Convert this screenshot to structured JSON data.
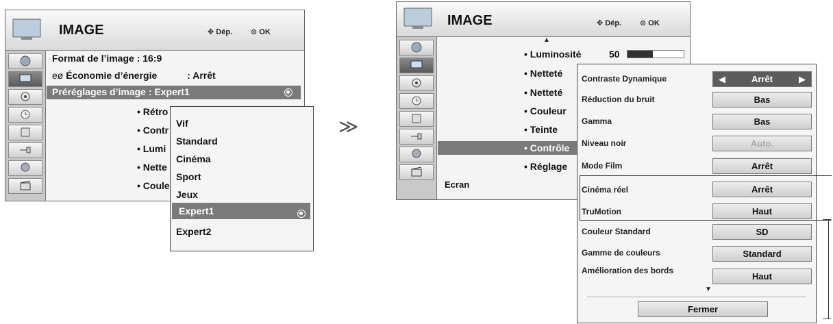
{
  "left": {
    "title": "IMAGE",
    "nav_hint": "Dép.",
    "ok_hint": "OK",
    "rows": {
      "format": "Format de l’image   : 16:9",
      "eco_label": "Économie d’énergie",
      "eco_value": ": Arrêt",
      "preset": "Préréglages d’image  :  Expert1"
    },
    "sub_items": [
      "• Rétro",
      "• Contr",
      "• Lumi",
      "• Nette",
      "• Coule"
    ],
    "dropdown": [
      "Vif",
      "Standard",
      "Cinéma",
      "Sport",
      "Jeux",
      "Expert1",
      "Expert2"
    ],
    "dropdown_selected": "Expert1"
  },
  "arrow": "≫",
  "right": {
    "title": "IMAGE",
    "nav_hint": "Dép.",
    "ok_hint": "OK",
    "list": [
      "• Luminosité",
      "• Netteté",
      "• Netteté",
      "• Couleur",
      "• Teinte",
      "• Contrôle",
      "• Réglage"
    ],
    "brightness_value": "50",
    "brightness_level": 0.45,
    "footer": "Ecran",
    "options": [
      {
        "label": "Contraste Dynamique",
        "value": "Arrêt"
      },
      {
        "label": "Réduction du bruit",
        "value": "Bas"
      },
      {
        "label": "Gamma",
        "value": "Bas"
      },
      {
        "label": "Niveau noir",
        "value": "Auto."
      },
      {
        "label": "Mode Film",
        "value": "Arrêt"
      },
      {
        "label": "Cinéma réel",
        "value": "Arrêt"
      },
      {
        "label": "TruMotion",
        "value": "Haut"
      },
      {
        "label": "Couleur Standard",
        "value": "SD"
      },
      {
        "label": "Gamme de couleurs",
        "value": "Standard"
      },
      {
        "label": "Amélioration des bords",
        "value": "Haut"
      }
    ],
    "close_label": "Fermer"
  },
  "colors": {
    "highlight": "#7a7a7a",
    "selected_box": "#5c5c5c"
  }
}
